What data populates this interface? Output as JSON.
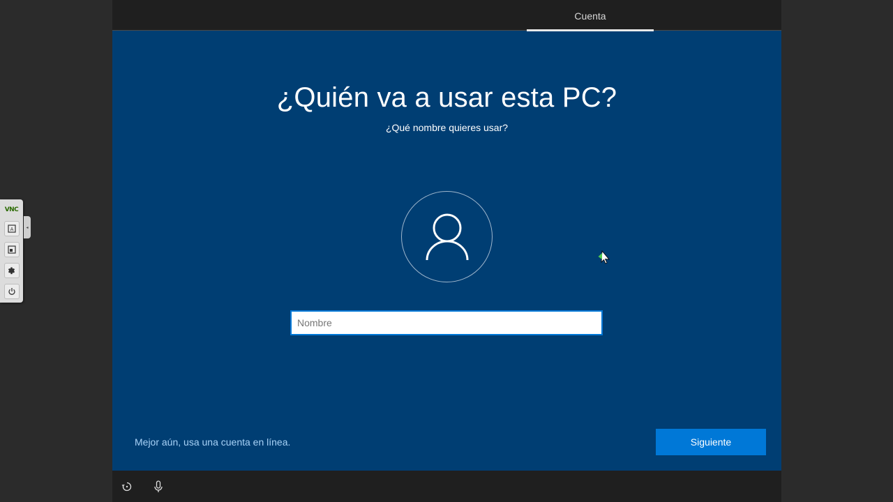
{
  "vnc": {
    "logo": "VNC",
    "tools": [
      "keyboard-icon",
      "fullscreen-icon",
      "settings-icon",
      "power-icon"
    ]
  },
  "topbar": {
    "active_tab": "Cuenta"
  },
  "main": {
    "title": "¿Quién va a usar esta PC?",
    "subtitle": "¿Qué nombre quieres usar?",
    "name_placeholder": "Nombre",
    "name_value": ""
  },
  "footer": {
    "online_link": "Mejor aún, usa una cuenta en línea.",
    "next_label": "Siguiente"
  },
  "bottombar": {
    "icons": [
      "ease-of-access-icon",
      "microphone-icon"
    ]
  },
  "colors": {
    "background": "#003e73",
    "accent": "#0078d7",
    "link": "#a8d2f7",
    "chrome": "#1f1f1f"
  }
}
